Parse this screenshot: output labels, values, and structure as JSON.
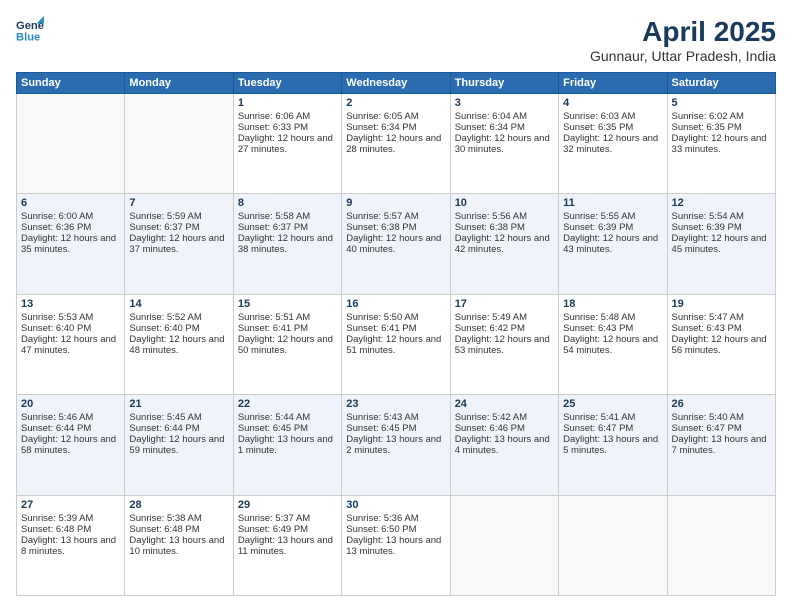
{
  "logo": {
    "line1": "General",
    "line2": "Blue"
  },
  "title": "April 2025",
  "subtitle": "Gunnaur, Uttar Pradesh, India",
  "weekdays": [
    "Sunday",
    "Monday",
    "Tuesday",
    "Wednesday",
    "Thursday",
    "Friday",
    "Saturday"
  ],
  "weeks": [
    [
      {
        "day": "",
        "sunrise": "",
        "sunset": "",
        "daylight": ""
      },
      {
        "day": "",
        "sunrise": "",
        "sunset": "",
        "daylight": ""
      },
      {
        "day": "1",
        "sunrise": "Sunrise: 6:06 AM",
        "sunset": "Sunset: 6:33 PM",
        "daylight": "Daylight: 12 hours and 27 minutes."
      },
      {
        "day": "2",
        "sunrise": "Sunrise: 6:05 AM",
        "sunset": "Sunset: 6:34 PM",
        "daylight": "Daylight: 12 hours and 28 minutes."
      },
      {
        "day": "3",
        "sunrise": "Sunrise: 6:04 AM",
        "sunset": "Sunset: 6:34 PM",
        "daylight": "Daylight: 12 hours and 30 minutes."
      },
      {
        "day": "4",
        "sunrise": "Sunrise: 6:03 AM",
        "sunset": "Sunset: 6:35 PM",
        "daylight": "Daylight: 12 hours and 32 minutes."
      },
      {
        "day": "5",
        "sunrise": "Sunrise: 6:02 AM",
        "sunset": "Sunset: 6:35 PM",
        "daylight": "Daylight: 12 hours and 33 minutes."
      }
    ],
    [
      {
        "day": "6",
        "sunrise": "Sunrise: 6:00 AM",
        "sunset": "Sunset: 6:36 PM",
        "daylight": "Daylight: 12 hours and 35 minutes."
      },
      {
        "day": "7",
        "sunrise": "Sunrise: 5:59 AM",
        "sunset": "Sunset: 6:37 PM",
        "daylight": "Daylight: 12 hours and 37 minutes."
      },
      {
        "day": "8",
        "sunrise": "Sunrise: 5:58 AM",
        "sunset": "Sunset: 6:37 PM",
        "daylight": "Daylight: 12 hours and 38 minutes."
      },
      {
        "day": "9",
        "sunrise": "Sunrise: 5:57 AM",
        "sunset": "Sunset: 6:38 PM",
        "daylight": "Daylight: 12 hours and 40 minutes."
      },
      {
        "day": "10",
        "sunrise": "Sunrise: 5:56 AM",
        "sunset": "Sunset: 6:38 PM",
        "daylight": "Daylight: 12 hours and 42 minutes."
      },
      {
        "day": "11",
        "sunrise": "Sunrise: 5:55 AM",
        "sunset": "Sunset: 6:39 PM",
        "daylight": "Daylight: 12 hours and 43 minutes."
      },
      {
        "day": "12",
        "sunrise": "Sunrise: 5:54 AM",
        "sunset": "Sunset: 6:39 PM",
        "daylight": "Daylight: 12 hours and 45 minutes."
      }
    ],
    [
      {
        "day": "13",
        "sunrise": "Sunrise: 5:53 AM",
        "sunset": "Sunset: 6:40 PM",
        "daylight": "Daylight: 12 hours and 47 minutes."
      },
      {
        "day": "14",
        "sunrise": "Sunrise: 5:52 AM",
        "sunset": "Sunset: 6:40 PM",
        "daylight": "Daylight: 12 hours and 48 minutes."
      },
      {
        "day": "15",
        "sunrise": "Sunrise: 5:51 AM",
        "sunset": "Sunset: 6:41 PM",
        "daylight": "Daylight: 12 hours and 50 minutes."
      },
      {
        "day": "16",
        "sunrise": "Sunrise: 5:50 AM",
        "sunset": "Sunset: 6:41 PM",
        "daylight": "Daylight: 12 hours and 51 minutes."
      },
      {
        "day": "17",
        "sunrise": "Sunrise: 5:49 AM",
        "sunset": "Sunset: 6:42 PM",
        "daylight": "Daylight: 12 hours and 53 minutes."
      },
      {
        "day": "18",
        "sunrise": "Sunrise: 5:48 AM",
        "sunset": "Sunset: 6:43 PM",
        "daylight": "Daylight: 12 hours and 54 minutes."
      },
      {
        "day": "19",
        "sunrise": "Sunrise: 5:47 AM",
        "sunset": "Sunset: 6:43 PM",
        "daylight": "Daylight: 12 hours and 56 minutes."
      }
    ],
    [
      {
        "day": "20",
        "sunrise": "Sunrise: 5:46 AM",
        "sunset": "Sunset: 6:44 PM",
        "daylight": "Daylight: 12 hours and 58 minutes."
      },
      {
        "day": "21",
        "sunrise": "Sunrise: 5:45 AM",
        "sunset": "Sunset: 6:44 PM",
        "daylight": "Daylight: 12 hours and 59 minutes."
      },
      {
        "day": "22",
        "sunrise": "Sunrise: 5:44 AM",
        "sunset": "Sunset: 6:45 PM",
        "daylight": "Daylight: 13 hours and 1 minute."
      },
      {
        "day": "23",
        "sunrise": "Sunrise: 5:43 AM",
        "sunset": "Sunset: 6:45 PM",
        "daylight": "Daylight: 13 hours and 2 minutes."
      },
      {
        "day": "24",
        "sunrise": "Sunrise: 5:42 AM",
        "sunset": "Sunset: 6:46 PM",
        "daylight": "Daylight: 13 hours and 4 minutes."
      },
      {
        "day": "25",
        "sunrise": "Sunrise: 5:41 AM",
        "sunset": "Sunset: 6:47 PM",
        "daylight": "Daylight: 13 hours and 5 minutes."
      },
      {
        "day": "26",
        "sunrise": "Sunrise: 5:40 AM",
        "sunset": "Sunset: 6:47 PM",
        "daylight": "Daylight: 13 hours and 7 minutes."
      }
    ],
    [
      {
        "day": "27",
        "sunrise": "Sunrise: 5:39 AM",
        "sunset": "Sunset: 6:48 PM",
        "daylight": "Daylight: 13 hours and 8 minutes."
      },
      {
        "day": "28",
        "sunrise": "Sunrise: 5:38 AM",
        "sunset": "Sunset: 6:48 PM",
        "daylight": "Daylight: 13 hours and 10 minutes."
      },
      {
        "day": "29",
        "sunrise": "Sunrise: 5:37 AM",
        "sunset": "Sunset: 6:49 PM",
        "daylight": "Daylight: 13 hours and 11 minutes."
      },
      {
        "day": "30",
        "sunrise": "Sunrise: 5:36 AM",
        "sunset": "Sunset: 6:50 PM",
        "daylight": "Daylight: 13 hours and 13 minutes."
      },
      {
        "day": "",
        "sunrise": "",
        "sunset": "",
        "daylight": ""
      },
      {
        "day": "",
        "sunrise": "",
        "sunset": "",
        "daylight": ""
      },
      {
        "day": "",
        "sunrise": "",
        "sunset": "",
        "daylight": ""
      }
    ]
  ]
}
